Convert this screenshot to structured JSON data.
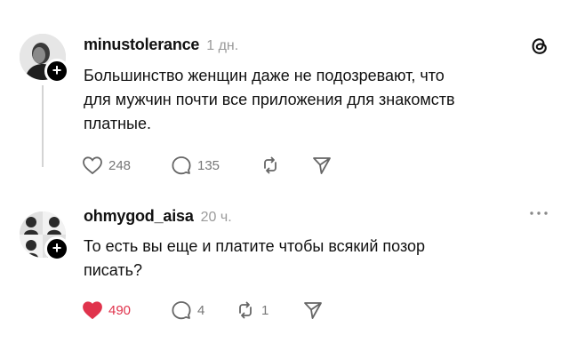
{
  "posts": [
    {
      "username": "minustolerance",
      "time": "1 дн.",
      "text_lines": [
        "Большинство женщин даже не подозревают, что",
        "для мужчин почти все приложения для знакомств",
        "платные."
      ],
      "likes": "248",
      "comments": "135",
      "reposts": "",
      "liked": false,
      "corner_icon": "threads-logo-icon"
    },
    {
      "username": "ohmygod_aisa",
      "time": "20 ч.",
      "text_lines": [
        "То есть вы еще и платите чтобы всякий позор",
        "писать?"
      ],
      "likes": "490",
      "comments": "4",
      "reposts": "1",
      "liked": true,
      "corner_icon": "more-options-icon"
    }
  ],
  "colors": {
    "like_active": "#e0334c",
    "muted_text": "#9a9a9a",
    "thread_line": "#d4d4d4"
  }
}
